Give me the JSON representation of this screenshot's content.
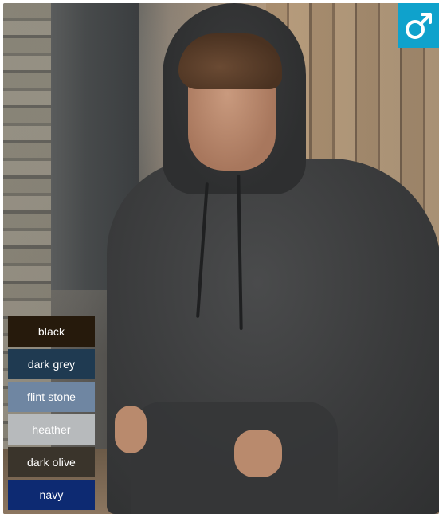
{
  "badge": {
    "icon": "male-symbol-icon",
    "color": "#0fa2cc"
  },
  "swatches": [
    {
      "label": "black",
      "color": "#261a0c"
    },
    {
      "label": "dark grey",
      "color": "#1f3a51"
    },
    {
      "label": "flint stone",
      "color": "#6f86a2"
    },
    {
      "label": "heather",
      "color": "#b7babc"
    },
    {
      "label": "dark olive",
      "color": "#3a342b"
    },
    {
      "label": "navy",
      "color": "#0d2a72"
    }
  ]
}
